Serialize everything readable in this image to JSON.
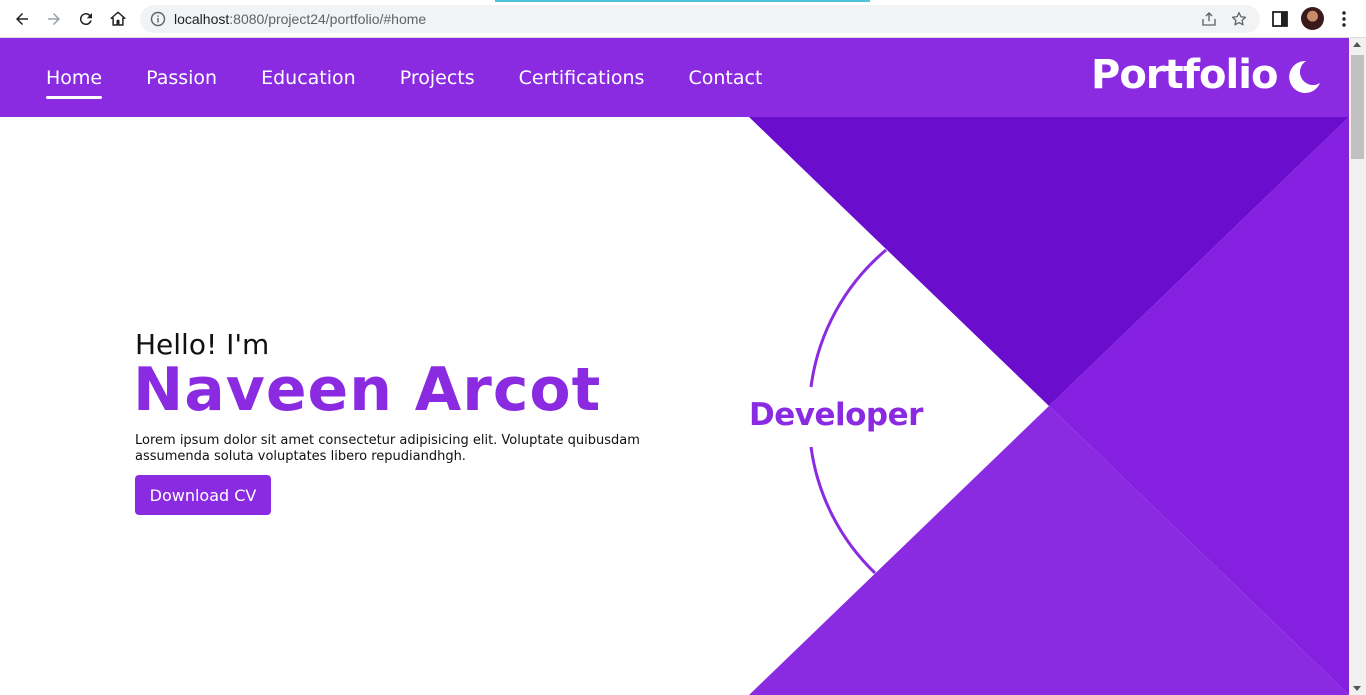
{
  "browser": {
    "url_host": "localhost",
    "url_rest": ":8080/project24/portfolio/#home"
  },
  "header": {
    "nav": [
      {
        "label": "Home",
        "active": true
      },
      {
        "label": "Passion",
        "active": false
      },
      {
        "label": "Education",
        "active": false
      },
      {
        "label": "Projects",
        "active": false
      },
      {
        "label": "Certifications",
        "active": false
      },
      {
        "label": "Contact",
        "active": false
      }
    ],
    "brand": "Portfolio",
    "theme_toggle_icon": "moon-icon"
  },
  "hero": {
    "greeting": "Hello! I'm",
    "name": "Naveen Arcot",
    "description": "Lorem ipsum dolor sit amet consectetur adipisicing elit. Voluptate quibusdam assumenda soluta voluptates libero repudiandhgh.",
    "cv_button": "Download CV",
    "role": "Developer"
  },
  "colors": {
    "accent": "#8a2be2",
    "accent_dark": "#6a0dcc",
    "accent_mid": "#8620e0",
    "white": "#ffffff"
  }
}
